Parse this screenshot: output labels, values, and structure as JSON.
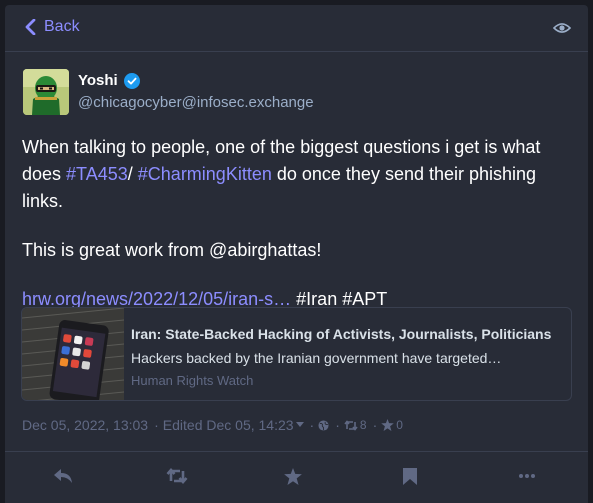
{
  "header": {
    "back_label": "Back",
    "back_icon": "chevron-left-icon",
    "visibility_icon": "eye-icon"
  },
  "post": {
    "author": {
      "display_name": "Yoshi",
      "handle": "@chicagocyber@infosec.exchange",
      "verified": true
    },
    "content": {
      "p1_a": "When talking to people, one of the biggest questions i get is what does ",
      "p1_tag1": "#TA453",
      "p1_b": "/ ",
      "p1_tag2": "#CharmingKitten",
      "p1_c": " do once they send their phishing links.",
      "p2_a": "This is great work from ",
      "p2_mention": "@abirghattas",
      "p2_b": "!",
      "p3_link": "hrw.org/news/2022/12/05/iran-s…",
      "p3_tag1": "#Iran",
      "p3_tag2": "#APT"
    },
    "card": {
      "title": "Iran: State-Backed Hacking of Activists, Journalists, Politicians",
      "description": "Hackers backed by the Iranian government have targeted…",
      "provider": "Human Rights Watch"
    },
    "meta": {
      "date": "Dec 05, 2022, 13:03",
      "edited": "Edited Dec 05, 14:23",
      "boosts": "8",
      "favourites": "0"
    }
  },
  "colors": {
    "background": "#191b22",
    "panel": "#282c37",
    "accent": "#8c8dff",
    "muted": "#606984",
    "secondary": "#9baec8"
  },
  "actions": [
    "reply-icon",
    "boost-icon",
    "favourite-icon",
    "bookmark-icon",
    "more-icon"
  ]
}
